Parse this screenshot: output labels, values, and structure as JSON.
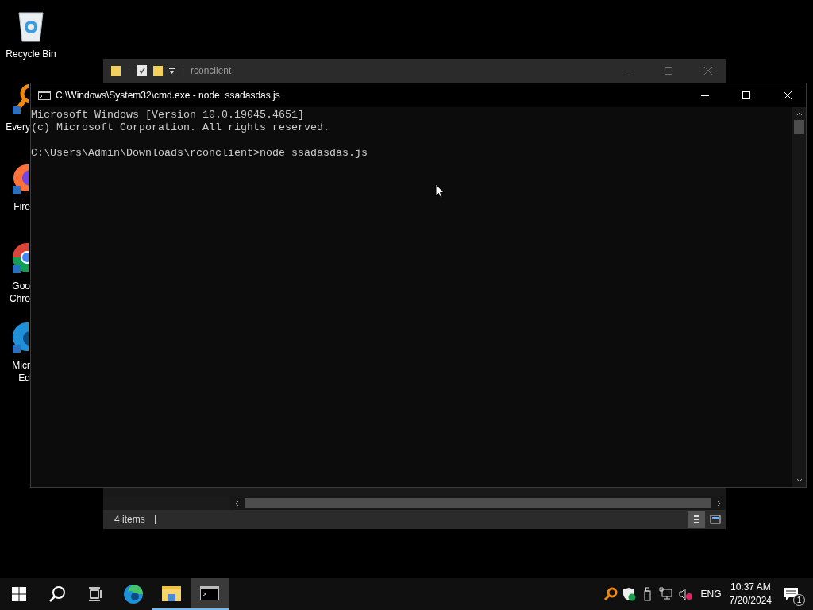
{
  "desktop_icons": [
    {
      "kind": "recycle_bin",
      "label_lines": [
        "Recycle Bin"
      ]
    },
    {
      "kind": "search_app",
      "label_lines": [
        "Every"
      ]
    },
    {
      "kind": "firefox",
      "label_lines": [
        "Fire"
      ]
    },
    {
      "kind": "chrome",
      "label_lines": [
        "Goo",
        "Chro"
      ]
    },
    {
      "kind": "edge",
      "label_lines": [
        "Micr",
        "Ed"
      ]
    }
  ],
  "explorer_window": {
    "title": "rconclient",
    "status_text": "4 items",
    "view_buttons": [
      {
        "kind": "details",
        "selected": true
      },
      {
        "kind": "tiles",
        "selected": false
      }
    ]
  },
  "cmd_window": {
    "title": "C:\\Windows\\System32\\cmd.exe - node  ssadasdas.js",
    "blocks": [
      [
        "Microsoft Windows [Version 10.0.19045.4651]",
        "(c) Microsoft Corporation. All rights reserved."
      ],
      [
        "C:\\Users\\Admin\\Downloads\\rconclient>node ssadasdas.js"
      ]
    ]
  },
  "taskbar": {
    "apps": [
      {
        "kind": "edge",
        "running": false,
        "selected": false
      },
      {
        "kind": "explorer",
        "running": true,
        "selected": false
      },
      {
        "kind": "terminal",
        "running": true,
        "selected": true
      }
    ],
    "tray": {
      "language": "ENG",
      "time": "10:37 AM",
      "date": "7/20/2024",
      "notification_count": "1"
    }
  }
}
